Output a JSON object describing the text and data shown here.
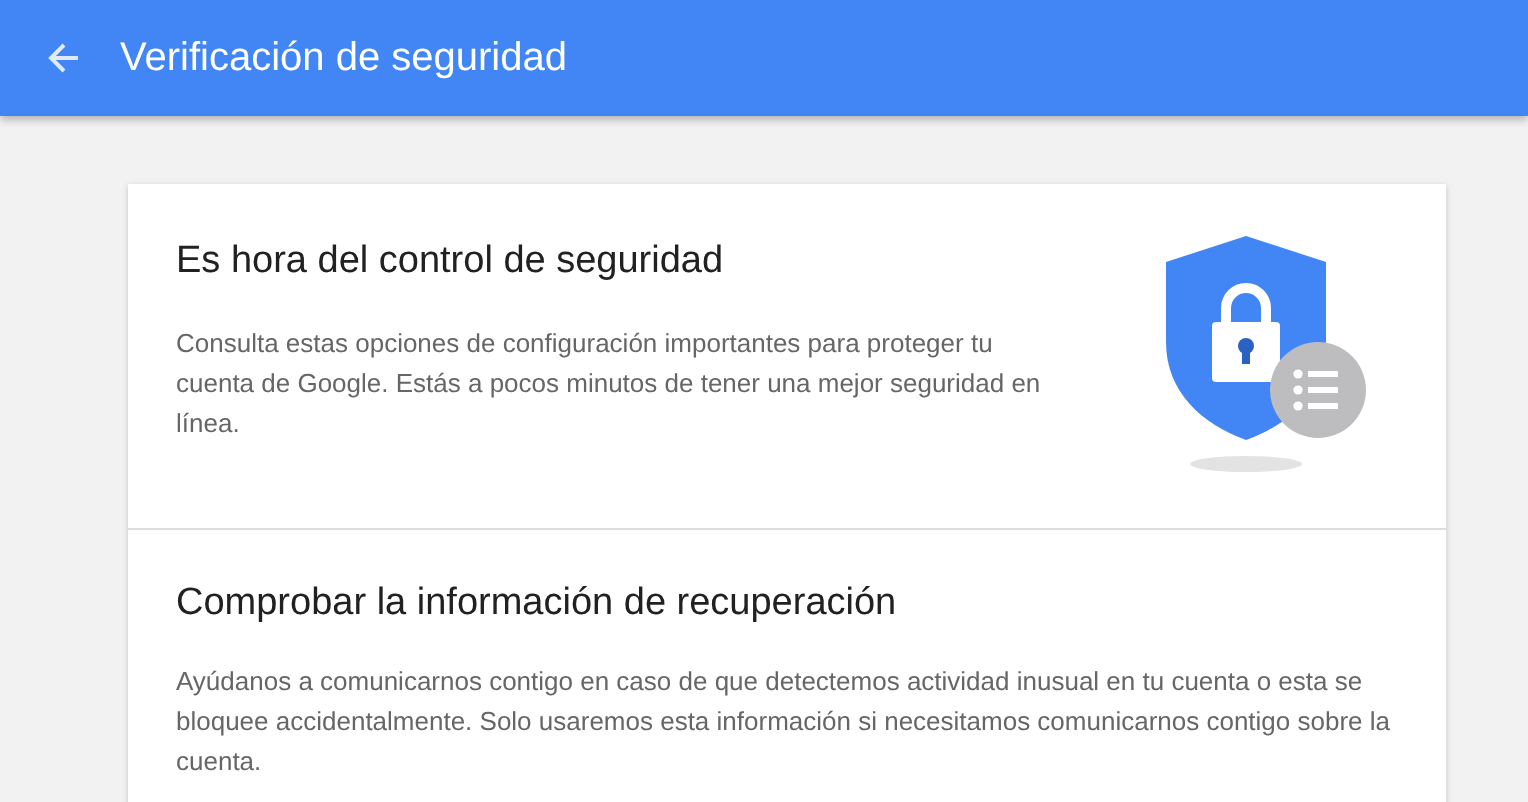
{
  "app_bar": {
    "title": "Verificación de seguridad"
  },
  "sections": [
    {
      "kind": "intro",
      "heading": "Es hora del control de seguridad",
      "body": "Consulta estas opciones de configuración importantes para proteger tu cuenta de Google. Estás a pocos minutos de tener una mejor seguridad en línea."
    },
    {
      "kind": "step",
      "heading": "Comprobar la información de recuperación",
      "body": "Ayúdanos a comunicarnos contigo en caso de que detectemos actividad inusual en tu cuenta o esta se bloquee accidentalmente. Solo usaremos esta información si necesitamos comunicarnos contigo sobre la cuenta."
    }
  ]
}
